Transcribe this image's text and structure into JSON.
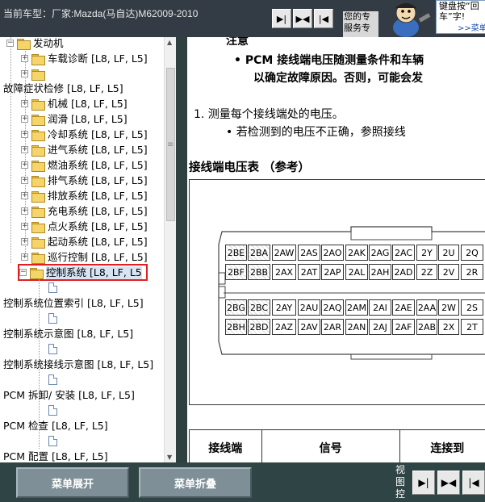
{
  "header": {
    "vehicle_info": "当前车型：厂家:Mazda(马自达)M62009-2010",
    "nav_buttons": [
      "▶|",
      "▶◀",
      "|◀"
    ],
    "promo": {
      "left_text": "您的专服务专",
      "bubble_text": "键盘按“回车”字!",
      "more_link": ">>菜单"
    }
  },
  "tree": {
    "items": [
      {
        "label": "发动机",
        "type": "folder"
      },
      {
        "label": "车载诊断 [L8, LF, L5]",
        "type": "folder"
      },
      {
        "label": "",
        "type": "folder"
      },
      {
        "label": "故障症状检修 [L8, LF, L5]",
        "type": "text"
      },
      {
        "label": "机械 [L8, LF, L5]",
        "type": "folder"
      },
      {
        "label": "润滑 [L8, LF, L5]",
        "type": "folder"
      },
      {
        "label": "冷却系统 [L8, LF, L5]",
        "type": "folder"
      },
      {
        "label": "进气系统 [L8, LF, L5]",
        "type": "folder"
      },
      {
        "label": "燃油系统 [L8, LF, L5]",
        "type": "folder"
      },
      {
        "label": "排气系统 [L8, LF, L5]",
        "type": "folder"
      },
      {
        "label": "排放系统 [L8, LF, L5]",
        "type": "folder"
      },
      {
        "label": "充电系统 [L8, LF, L5]",
        "type": "folder"
      },
      {
        "label": "点火系统 [L8, LF, L5]",
        "type": "folder"
      },
      {
        "label": "起动系统 [L8, LF, L5]",
        "type": "folder"
      },
      {
        "label": "巡行控制 [L8, LF, L5]",
        "type": "folder"
      },
      {
        "label": "控制系统 [L8, LF, L5",
        "type": "folder"
      },
      {
        "label": "控制系统位置索引 [L8, LF, L5]",
        "type": "text"
      },
      {
        "label": "控制系统示意图 [L8, LF, L5]",
        "type": "text"
      },
      {
        "label": "控制系统接线示意图 [L8, LF, L5]",
        "type": "text"
      },
      {
        "label": "PCM 拆卸/ 安装 [L8, LF, L5]",
        "type": "text"
      },
      {
        "label": "PCM 检查 [L8, LF, L5]",
        "type": "text"
      },
      {
        "label": "PCM 配置 [L8, LF, L5]",
        "type": "text"
      }
    ]
  },
  "content": {
    "note_title": "注意",
    "bullet1_line1": "•  PCM 接线端电压随测量条件和车辆",
    "bullet1_line2": "以确定故障原因。否则，可能会发",
    "step1": "1.  测量每个接线端处的电压。",
    "step1_bullet": "•  若检测到的电压不正确，参照接线",
    "table_title": "接线端电压表 （参考）",
    "connector_rows": [
      [
        "2BE",
        "2BA",
        "2AW",
        "2AS",
        "2AO",
        "2AK",
        "2AG",
        "2AC",
        "2Y",
        "2U",
        "2Q"
      ],
      [
        "2BF",
        "2BB",
        "2AX",
        "2AT",
        "2AP",
        "2AL",
        "2AH",
        "2AD",
        "2Z",
        "2V",
        "2R"
      ],
      [
        "2BG",
        "2BC",
        "2AY",
        "2AU",
        "2AQ",
        "2AM",
        "2AI",
        "2AE",
        "2AA",
        "2W",
        "2S"
      ],
      [
        "2BH",
        "2BD",
        "2AZ",
        "2AV",
        "2AR",
        "2AN",
        "2AJ",
        "2AF",
        "2AB",
        "2X",
        "2T"
      ]
    ],
    "table_headers": [
      "接线端",
      "信号",
      "连接到"
    ]
  },
  "footer": {
    "expand_label": "菜单展开",
    "collapse_label": "菜单折叠",
    "view_label": "视图控",
    "view_buttons": [
      "▶|",
      "▶◀",
      "|◀"
    ]
  }
}
